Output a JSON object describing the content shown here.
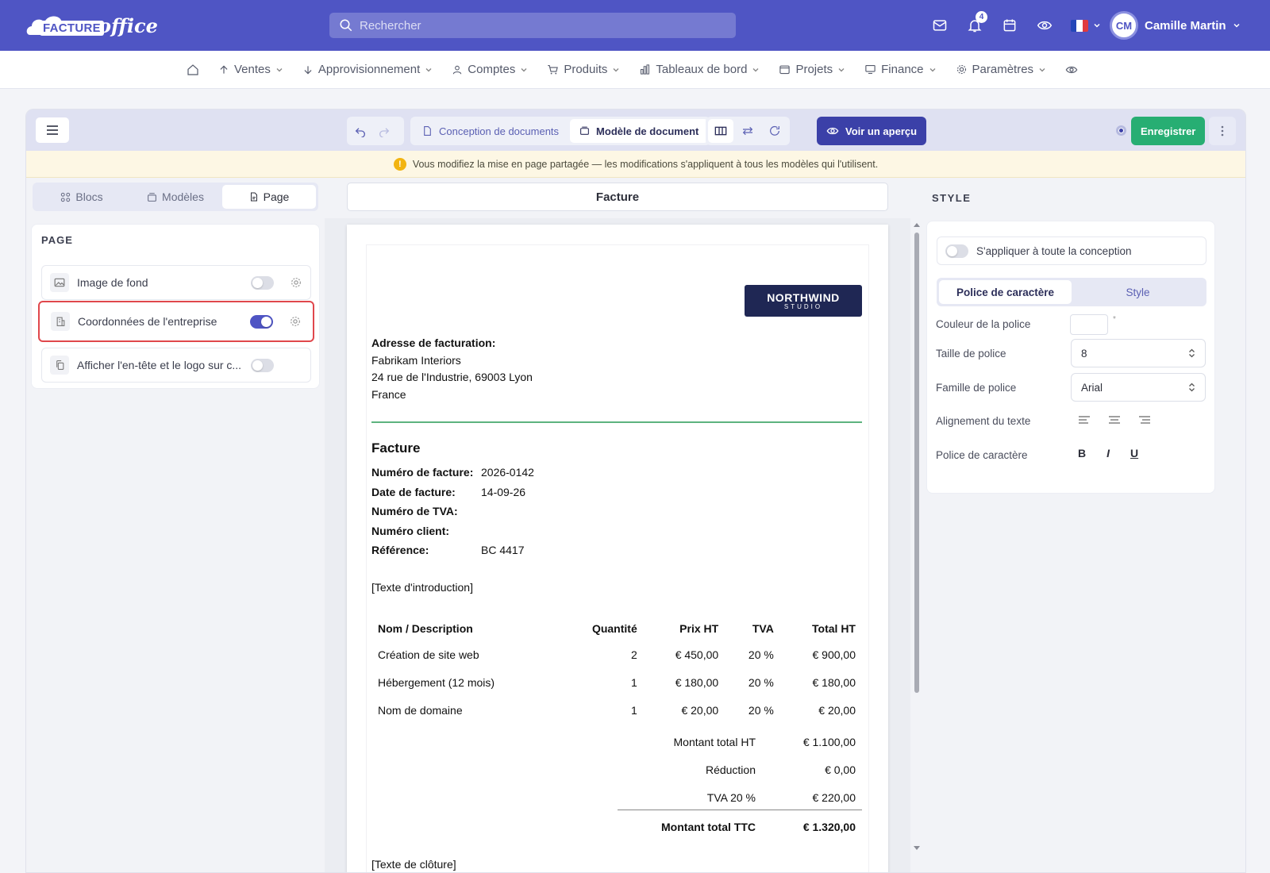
{
  "header": {
    "logo_badge": "FACTURE",
    "logo_script": "office",
    "search_placeholder": "Rechercher",
    "notifications_count": "4",
    "user_initials": "CM",
    "user_name": "Camille Martin"
  },
  "nav": {
    "items": [
      {
        "label": "Ventes",
        "icon": "arrow-up-icon"
      },
      {
        "label": "Approvisionnement",
        "icon": "arrow-down-icon"
      },
      {
        "label": "Comptes",
        "icon": "user-icon"
      },
      {
        "label": "Produits",
        "icon": "cart-icon"
      },
      {
        "label": "Tableaux de bord",
        "icon": "bar-chart-icon"
      },
      {
        "label": "Projets",
        "icon": "folder-icon"
      },
      {
        "label": "Finance",
        "icon": "monitor-icon"
      },
      {
        "label": "Paramètres",
        "icon": "gear-icon"
      }
    ]
  },
  "toolbar": {
    "tab_design": "Conception de documents",
    "tab_template": "Modèle de document",
    "preview_label": "Voir un aperçu",
    "save_label": "Enregistrer"
  },
  "warning": {
    "text": "Vous modifiez la mise en page partagée — les modifications s'appliquent à tous les modèles qui l'utilisent."
  },
  "left": {
    "tabs": [
      "Blocs",
      "Modèles",
      "Page"
    ],
    "panel_title": "PAGE",
    "options": [
      {
        "label": "Image de fond",
        "on": false
      },
      {
        "label": "Coordonnées de l'entreprise",
        "on": true
      },
      {
        "label": "Afficher l'en-tête et le logo sur c...",
        "on": false
      }
    ]
  },
  "document": {
    "title": "Facture",
    "logo_main": "NORTHWIND",
    "logo_sub": "STUDIO",
    "billing_label": "Adresse de facturation:",
    "billing_name": "Fabrikam Interiors",
    "billing_street": "24 rue de l'Industrie, 69003 Lyon",
    "billing_country": "France",
    "heading": "Facture",
    "meta": [
      {
        "label": "Numéro de facture:",
        "value": "2026-0142"
      },
      {
        "label": "Date de facture:",
        "value": "14-09-26"
      },
      {
        "label": "Numéro de TVA:",
        "value": ""
      },
      {
        "label": "Numéro client:",
        "value": ""
      },
      {
        "label": "Référence:",
        "value": "BC 4417"
      }
    ],
    "intro": "[Texte d'introduction]",
    "columns": [
      "Nom / Description",
      "Quantité",
      "Prix HT",
      "TVA",
      "Total HT"
    ],
    "rows": [
      [
        "Création de site web",
        "2",
        "€ 450,00",
        "20 %",
        "€ 900,00"
      ],
      [
        "Hébergement (12 mois)",
        "1",
        "€ 180,00",
        "20 %",
        "€ 180,00"
      ],
      [
        "Nom de domaine",
        "1",
        "€ 20,00",
        "20 %",
        "€ 20,00"
      ]
    ],
    "totals": [
      {
        "label": "Montant total HT",
        "value": "€ 1.100,00"
      },
      {
        "label": "Réduction",
        "value": "€ 0,00"
      },
      {
        "label": "TVA 20 %",
        "value": "€ 220,00"
      }
    ],
    "grand_total_label": "Montant total TTC",
    "grand_total_value": "€ 1.320,00",
    "closing": "[Texte de clôture]"
  },
  "right": {
    "title": "STYLE",
    "apply_all": "S'appliquer à toute la conception",
    "tabs": [
      "Police de caractère",
      "Style"
    ],
    "font_color_label": "Couleur de la police",
    "font_color_marker": "*",
    "font_size_label": "Taille de police",
    "font_size_value": "8",
    "font_family_label": "Famille de police",
    "font_family_value": "Arial",
    "align_label": "Alignement du texte",
    "style_label": "Police de caractère",
    "bold": "B",
    "italic": "I",
    "underline": "U"
  },
  "colors": {
    "brand": "#4f55c4",
    "save": "#27ae73",
    "preview": "#3b40a8",
    "highlight": "#e0474c",
    "divider": "#5db37e"
  }
}
